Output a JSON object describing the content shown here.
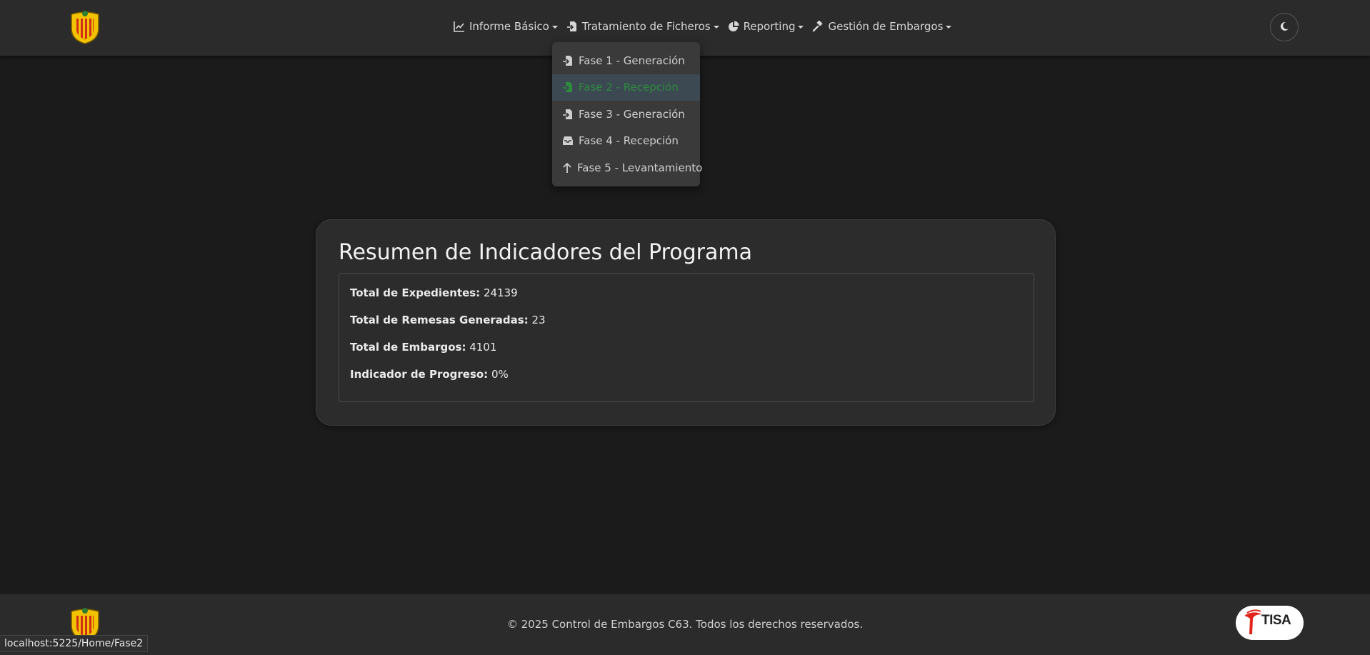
{
  "nav": {
    "items": [
      {
        "label": "Informe Básico",
        "icon": "chart-line-icon"
      },
      {
        "label": "Tratamiento de Ficheros",
        "icon": "file-import-icon"
      },
      {
        "label": "Reporting",
        "icon": "pie-chart-icon"
      },
      {
        "label": "Gestión de Embargos",
        "icon": "gavel-icon"
      }
    ],
    "theme_toggle_icon": "moon-icon"
  },
  "dropdown": {
    "items": [
      {
        "label": "Fase 1 - Generación",
        "icon": "file-export-icon"
      },
      {
        "label": "Fase 2 - Recepción",
        "icon": "file-import-icon",
        "active": true
      },
      {
        "label": "Fase 3 - Generación",
        "icon": "file-export-icon"
      },
      {
        "label": "Fase 4 - Recepción",
        "icon": "inbox-icon"
      },
      {
        "label": "Fase 5 - Levantamiento",
        "icon": "arrow-up-icon"
      }
    ]
  },
  "card": {
    "title": "Resumen de Indicadores del Programa",
    "metrics": [
      {
        "label": "Total de Expedientes:",
        "value": "24139"
      },
      {
        "label": "Total de Remesas Generadas:",
        "value": "23"
      },
      {
        "label": "Total de Embargos:",
        "value": "4101"
      },
      {
        "label": "Indicador de Progreso:",
        "value": "0%"
      }
    ]
  },
  "footer": {
    "text": "© 2025 Control de Embargos C63. Todos los derechos reservados.",
    "partner_logo_text": "TISA"
  },
  "status_bar_url": "localhost:5225/Home/Fase2",
  "colors": {
    "background": "#1b1b1b",
    "navbar": "#2b2b2b",
    "card": "#2c2c2c",
    "active_item_text": "#2e8b3e",
    "active_item_bg": "#3c4852"
  }
}
